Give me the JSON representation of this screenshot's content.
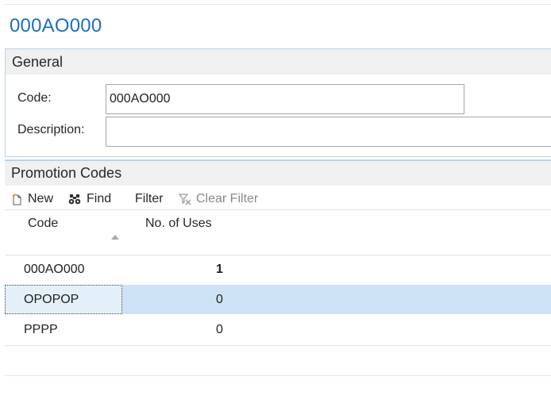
{
  "page": {
    "title": "000AO000"
  },
  "general": {
    "header": "General",
    "code_label": "Code:",
    "code_value": "000AO000",
    "description_label": "Description:",
    "description_value": ""
  },
  "promotion_codes": {
    "header": "Promotion Codes",
    "toolbar": {
      "new": "New",
      "find": "Find",
      "filter": "Filter",
      "clear_filter": "Clear Filter"
    },
    "columns": {
      "code": "Code",
      "uses": "No. of Uses"
    },
    "sort": {
      "column": "code",
      "direction": "ascending"
    },
    "rows": [
      {
        "code": "000AO000",
        "uses": "1",
        "selected": false
      },
      {
        "code": "OPOPOP",
        "uses": "0",
        "selected": true
      },
      {
        "code": "PPPP",
        "uses": "0",
        "selected": false
      }
    ]
  },
  "colors": {
    "accent": "#1f6ebd",
    "selected_row": "#cde3f5",
    "section_border": "#b9d1ee"
  },
  "icons": [
    "new-document-icon",
    "binoculars-icon",
    "clear-filter-icon",
    "sort-ascending-icon"
  ]
}
